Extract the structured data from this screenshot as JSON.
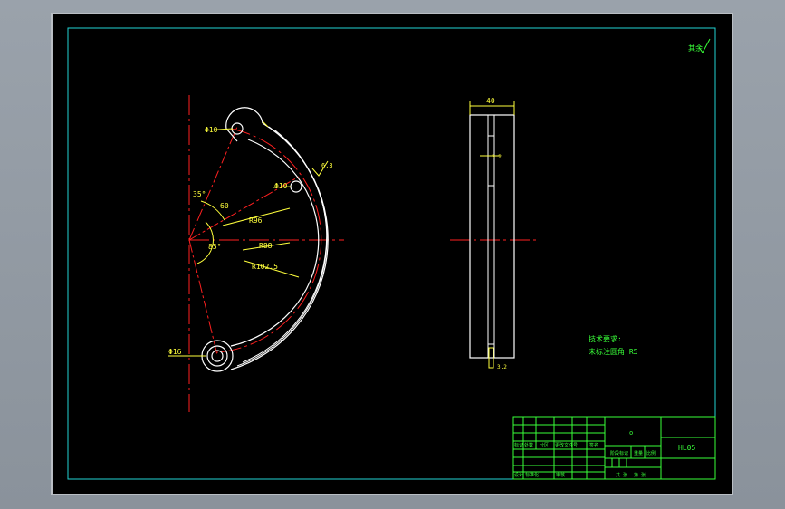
{
  "dimensions": {
    "phi10_top": "Φ10",
    "phi10_mid": "Φ10",
    "phi16_bottom": "Φ16",
    "angle_35": "35°",
    "dim_60": "60",
    "r96": "R96",
    "r88": "R88",
    "r1025": "R102.5",
    "angle_inner": "85°",
    "roughness_arc": "6.3",
    "side_width": "40",
    "side_tol": "3.2",
    "side_bottom": "3.2"
  },
  "corner_mark": "其余",
  "notes": {
    "title": "技术要求:",
    "line1": "未标注圆角 R5"
  },
  "title_block": {
    "center_mark": "o",
    "drawing_no": "HL05",
    "row_labels": [
      "标记",
      "处数",
      "分区",
      "更改文件号",
      "签名"
    ],
    "mid_labels": [
      "阶段标记",
      "重量",
      "比例"
    ],
    "bottom_labels": [
      "设计",
      "标准化",
      "审核"
    ],
    "sheet_labels": [
      "共 张",
      "第 张"
    ]
  },
  "colors": {
    "outline": "#ffffff",
    "center_line": "#ff2020",
    "dimension": "#ffff3c",
    "frame": "#39ff39"
  }
}
